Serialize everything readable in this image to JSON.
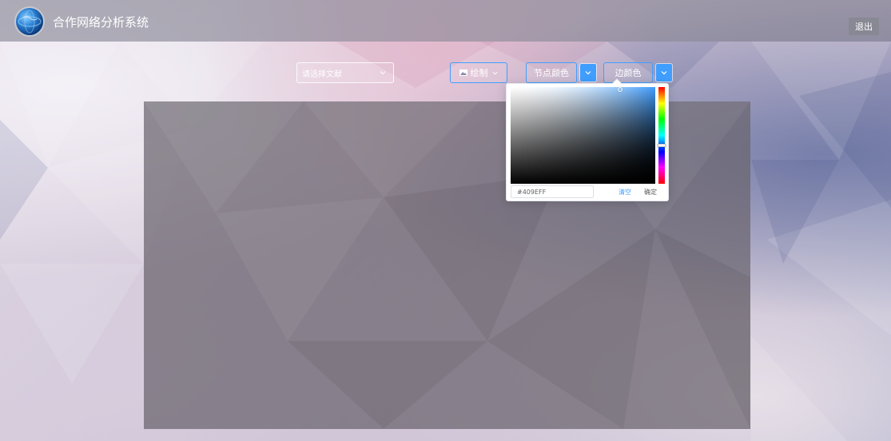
{
  "header": {
    "title": "合作网络分析系统",
    "logout_label": "退出",
    "logo_icon": "globe-icon"
  },
  "toolbar": {
    "file_select": {
      "placeholder": "请选择文献",
      "icon": "chevron-down-icon"
    },
    "draw_button": {
      "label": "绘制",
      "icon": "image-icon"
    },
    "node_color_label": "节点颜色",
    "edge_color_label": "边颜色"
  },
  "color_picker": {
    "hex_value": "#409EFF",
    "clear_label": "清空",
    "confirm_label": "确定",
    "selected_color": "#409EFF",
    "hue_position": 0.6
  },
  "colors": {
    "accent": "#409EFF",
    "header_text": "#ffffff"
  }
}
